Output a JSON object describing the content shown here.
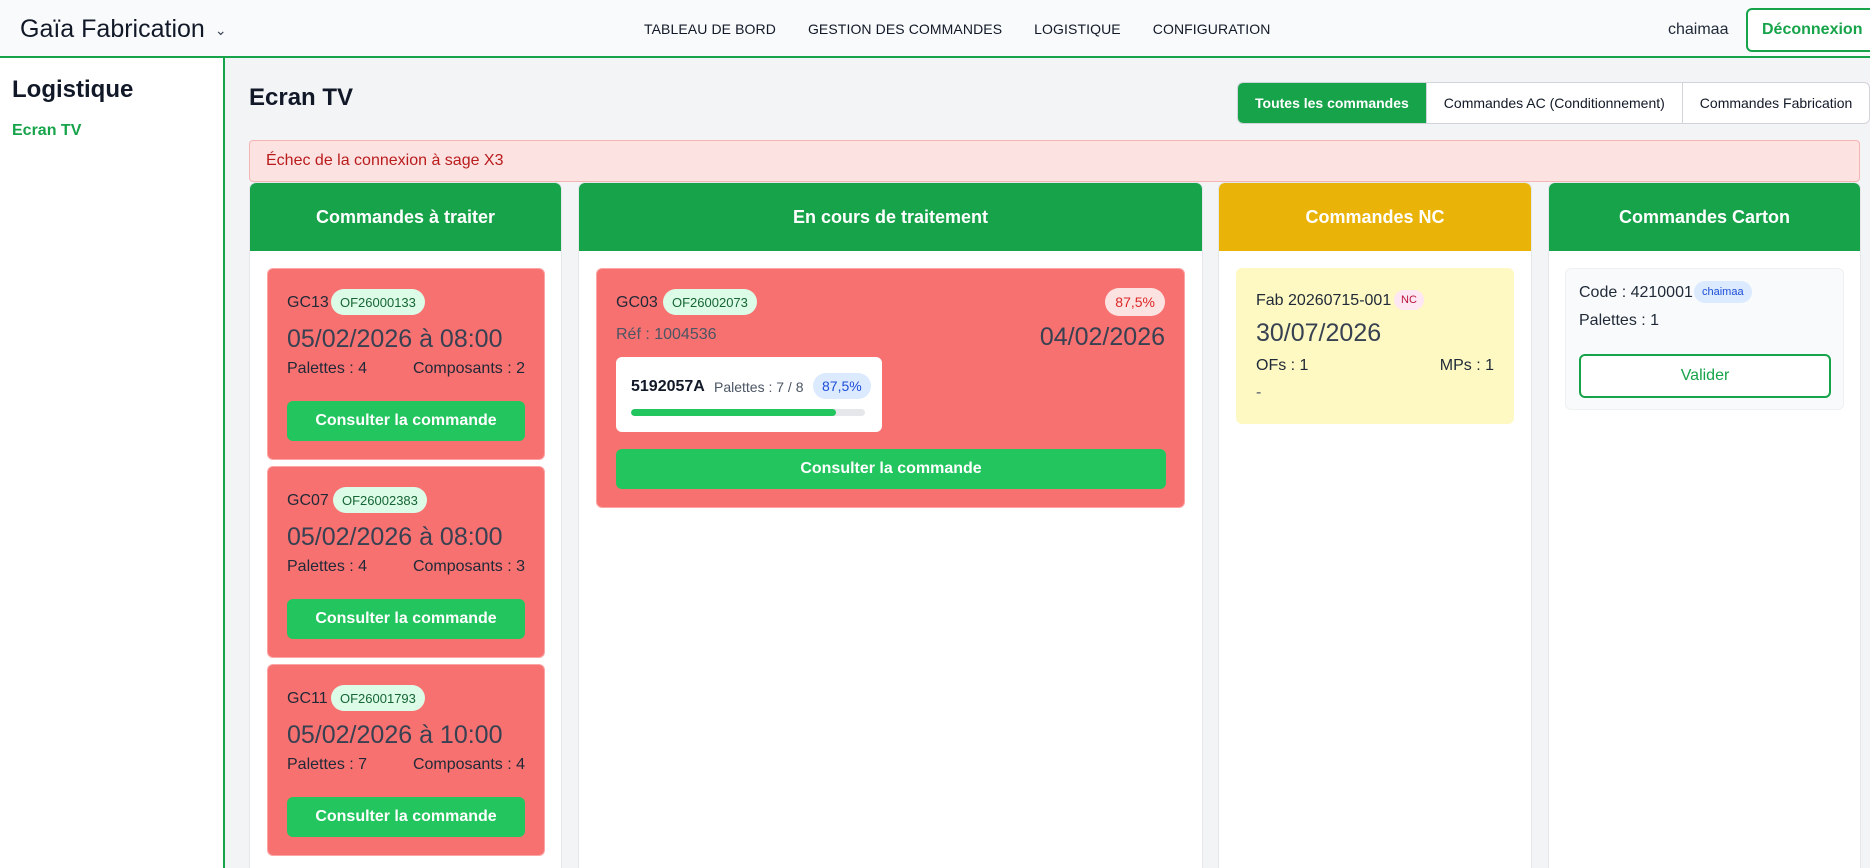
{
  "app": {
    "brand": "Gaïa Fabrication"
  },
  "nav": {
    "items": [
      "TABLEAU DE BORD",
      "GESTION DES COMMANDES",
      "LOGISTIQUE",
      "CONFIGURATION"
    ],
    "user": "chaimaa",
    "logout": "Déconnexion"
  },
  "sidebar": {
    "title": "Logistique",
    "link": "Ecran TV"
  },
  "page": {
    "title": "Ecran TV"
  },
  "tabs": [
    "Toutes les commandes",
    "Commandes AC (Conditionnement)",
    "Commandes Fabrication"
  ],
  "alert": "Échec de la connexion à sage X3",
  "columns": {
    "a_traiter": {
      "title": "Commandes à traiter",
      "cards": [
        {
          "code": "GC13",
          "of": "OF26000133",
          "date": "05/02/2026 à 08:00",
          "palettes": "Palettes : 4",
          "composants": "Composants : 2",
          "button": "Consulter la commande"
        },
        {
          "code": "GC07",
          "of": "OF26002383",
          "date": "05/02/2026 à 08:00",
          "palettes": "Palettes : 4",
          "composants": "Composants : 3",
          "button": "Consulter la commande"
        },
        {
          "code": "GC11",
          "of": "OF26001793",
          "date": "05/02/2026 à 10:00",
          "palettes": "Palettes : 7",
          "composants": "Composants : 4",
          "button": "Consulter la commande"
        }
      ]
    },
    "en_cours": {
      "title": "En cours de traitement",
      "card": {
        "code": "GC03",
        "of": "OF26002073",
        "percent": "87,5%",
        "ref": "Réf : 1004536",
        "date": "04/02/2026",
        "item": {
          "code": "5192057A",
          "palettes": "Palettes : 7 / 8",
          "percent": "87,5%",
          "progress": 0.875
        },
        "button": "Consulter la commande"
      }
    },
    "nc": {
      "title": "Commandes NC",
      "card": {
        "label": "Fab 20260715-001",
        "badge": "NC",
        "date": "30/07/2026",
        "ofs": "OFs : 1",
        "mps": "MPs : 1",
        "note": "-"
      }
    },
    "carton": {
      "title": "Commandes Carton",
      "card": {
        "code": "Code : 4210001",
        "user": "chaimaa",
        "palettes": "Palettes : 1",
        "button": "Valider"
      }
    }
  },
  "colors": {
    "primary": "#16a34a",
    "danger_card": "#f87171",
    "nc_header": "#eab308",
    "nc_card": "#fef9c3"
  }
}
